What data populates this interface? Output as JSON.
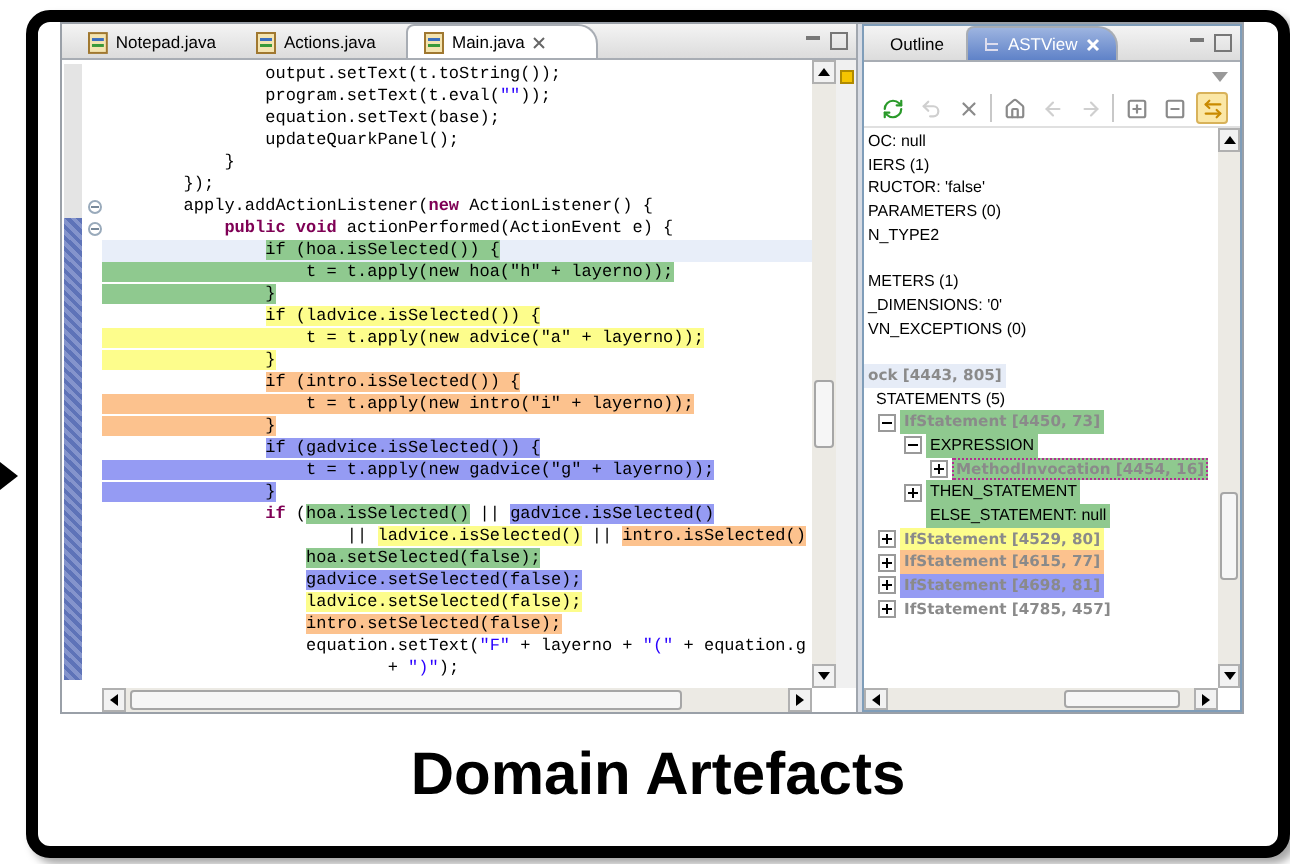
{
  "editor": {
    "tabs": [
      {
        "label": "Notepad.java",
        "selected": false
      },
      {
        "label": "Actions.java",
        "selected": false
      },
      {
        "label": "Main.java",
        "selected": true
      }
    ],
    "lines": [
      {
        "current": false,
        "range": false,
        "fold": false,
        "segments": [
          {
            "text": "                output.setText(t.toString());"
          }
        ]
      },
      {
        "current": false,
        "range": false,
        "fold": false,
        "segments": [
          {
            "text": "                program.setText(t.eval("
          },
          {
            "text": "\"\"",
            "kind": "string"
          },
          {
            "text": "));"
          }
        ]
      },
      {
        "current": false,
        "range": false,
        "fold": false,
        "segments": [
          {
            "text": "                equation.setText(base);"
          }
        ]
      },
      {
        "current": false,
        "range": false,
        "fold": false,
        "segments": [
          {
            "text": "                updateQuarkPanel();"
          }
        ]
      },
      {
        "current": false,
        "range": false,
        "fold": false,
        "segments": [
          {
            "text": "            }"
          }
        ]
      },
      {
        "current": false,
        "range": false,
        "fold": false,
        "segments": [
          {
            "text": "        });"
          }
        ]
      },
      {
        "current": false,
        "range": false,
        "fold": true,
        "segments": [
          {
            "text": "        apply.addActionListener("
          },
          {
            "text": "new",
            "kind": "keyword"
          },
          {
            "text": " ActionListener() {"
          }
        ]
      },
      {
        "current": false,
        "range": true,
        "fold": true,
        "segments": [
          {
            "text": "            public void",
            "kind": "keyword"
          },
          {
            "text": " actionPerformed(ActionEvent e) {"
          }
        ]
      },
      {
        "current": true,
        "range": true,
        "fold": false,
        "segments": [
          {
            "text": "                if (hoa.isSelected()) {",
            "color": "#8fc98f",
            "full": false
          }
        ]
      },
      {
        "current": false,
        "range": true,
        "fold": false,
        "segments": [
          {
            "text": "                    t = t.apply(new hoa(\"h\" + layerno));",
            "color": "#8fc98f",
            "full": true
          }
        ]
      },
      {
        "current": false,
        "range": true,
        "fold": false,
        "segments": [
          {
            "text": "                }",
            "color": "#8fc98f",
            "full": true
          }
        ]
      },
      {
        "current": false,
        "range": true,
        "fold": false,
        "segments": [
          {
            "text": "                if (ladvice.isSelected()) {",
            "color": "#fdfd8c",
            "full": false
          }
        ]
      },
      {
        "current": false,
        "range": true,
        "fold": false,
        "segments": [
          {
            "text": "                    t = t.apply(new advice(\"a\" + layerno));",
            "color": "#fdfd8c",
            "full": true
          }
        ]
      },
      {
        "current": false,
        "range": true,
        "fold": false,
        "segments": [
          {
            "text": "                }",
            "color": "#fdfd8c",
            "full": true
          }
        ]
      },
      {
        "current": false,
        "range": true,
        "fold": false,
        "segments": [
          {
            "text": "                if (intro.isSelected()) {",
            "color": "#fcc28e",
            "full": false
          }
        ]
      },
      {
        "current": false,
        "range": true,
        "fold": false,
        "segments": [
          {
            "text": "                    t = t.apply(new intro(\"i\" + layerno));",
            "color": "#fcc28e",
            "full": true
          }
        ]
      },
      {
        "current": false,
        "range": true,
        "fold": false,
        "segments": [
          {
            "text": "                }",
            "color": "#fcc28e",
            "full": true
          }
        ]
      },
      {
        "current": false,
        "range": true,
        "fold": false,
        "segments": [
          {
            "text": "                if (gadvice.isSelected()) {",
            "color": "#959bf3",
            "full": false
          }
        ]
      },
      {
        "current": false,
        "range": true,
        "fold": false,
        "segments": [
          {
            "text": "                    t = t.apply(new gadvice(\"g\" + layerno));",
            "color": "#959bf3",
            "full": true
          }
        ]
      },
      {
        "current": false,
        "range": true,
        "fold": false,
        "segments": [
          {
            "text": "                }",
            "color": "#959bf3",
            "full": true
          }
        ]
      },
      {
        "current": false,
        "range": true,
        "fold": false,
        "segments": [
          {
            "text": "                if",
            "kind": "keyword"
          },
          {
            "text": " ("
          },
          {
            "text": "hoa.isSelected()",
            "color": "#8fc98f"
          },
          {
            "text": " || "
          },
          {
            "text": "gadvice.isSelected()",
            "color": "#959bf3"
          }
        ]
      },
      {
        "current": false,
        "range": true,
        "fold": false,
        "segments": [
          {
            "text": "                        || "
          },
          {
            "text": "ladvice.isSelected()",
            "color": "#fdfd8c"
          },
          {
            "text": " || "
          },
          {
            "text": "intro.isSelected()",
            "color": "#fcc28e"
          }
        ]
      },
      {
        "current": false,
        "range": true,
        "fold": false,
        "segments": [
          {
            "text": "                    hoa.setSelected(false);",
            "color": "#8fc98f",
            "full": false
          }
        ]
      },
      {
        "current": false,
        "range": true,
        "fold": false,
        "segments": [
          {
            "text": "                    gadvice.setSelected(false);",
            "color": "#959bf3",
            "full": false
          }
        ]
      },
      {
        "current": false,
        "range": true,
        "fold": false,
        "segments": [
          {
            "text": "                    ladvice.setSelected(false);",
            "color": "#fdfd8c",
            "full": false
          }
        ]
      },
      {
        "current": false,
        "range": true,
        "fold": false,
        "segments": [
          {
            "text": "                    intro.setSelected(false);",
            "color": "#fcc28e",
            "full": false
          }
        ]
      },
      {
        "current": false,
        "range": true,
        "fold": false,
        "segments": [
          {
            "text": "                    equation.setText("
          },
          {
            "text": "\"F\"",
            "kind": "string"
          },
          {
            "text": " + layerno + "
          },
          {
            "text": "\"(\"",
            "kind": "string"
          },
          {
            "text": " + equation.g"
          }
        ]
      },
      {
        "current": false,
        "range": true,
        "fold": false,
        "segments": [
          {
            "text": "                            + "
          },
          {
            "text": "\")\"",
            "kind": "string"
          },
          {
            "text": ");"
          }
        ]
      }
    ]
  },
  "view": {
    "tabs": [
      {
        "label": "Outline",
        "selected": false
      },
      {
        "label": "ASTView",
        "selected": true
      }
    ],
    "toolbar": [
      {
        "kind": "refresh",
        "disabled": false,
        "selected": false
      },
      {
        "kind": "undo",
        "disabled": true,
        "selected": false
      },
      {
        "kind": "delete",
        "disabled": false,
        "selected": false
      },
      {
        "kind": "home",
        "disabled": false,
        "selected": false
      },
      {
        "kind": "back",
        "disabled": true,
        "selected": false
      },
      {
        "kind": "forward",
        "disabled": true,
        "selected": false
      },
      {
        "kind": "expand",
        "disabled": false,
        "selected": false
      },
      {
        "kind": "collapse",
        "disabled": false,
        "selected": false
      },
      {
        "kind": "link",
        "disabled": false,
        "selected": true
      }
    ],
    "tree_groups": [
      [
        {
          "label": "OC: null",
          "kind": "property",
          "selected": false
        },
        {
          "label": "IERS (1)",
          "kind": "property",
          "selected": false
        },
        {
          "label": "RUCTOR: 'false'",
          "kind": "property",
          "selected": false
        },
        {
          "label": "PARAMETERS (0)",
          "kind": "property",
          "selected": false
        },
        {
          "label": "N_TYPE2",
          "kind": "property",
          "selected": false
        }
      ],
      [
        {
          "label": "METERS (1)",
          "kind": "property",
          "selected": false
        },
        {
          "label": "_DIMENSIONS: '0'",
          "kind": "property",
          "selected": false
        },
        {
          "label": "VN_EXCEPTIONS (0)",
          "kind": "property",
          "selected": false
        }
      ],
      [
        {
          "label": "ock [4443, 805]",
          "kind": "node",
          "selected": false,
          "color": "#e6ecf7",
          "children": [
            {
              "label": "STATEMENTS (5)",
              "kind": "property",
              "selected": false,
              "children": [
                {
                  "label": "IfStatement [4450, 73]",
                  "kind": "node",
                  "selected": false,
                  "expanded": true,
                  "color": "#8fc98f",
                  "children": [
                    {
                      "label": "EXPRESSION",
                      "kind": "property",
                      "selected": false,
                      "expanded": true,
                      "color": "#8fc98f",
                      "children": [
                        {
                          "label": "MethodInvocation [4454, 16]",
                          "kind": "node",
                          "selected": true,
                          "expanded": false,
                          "color": "#8fc98f"
                        }
                      ]
                    },
                    {
                      "label": "THEN_STATEMENT",
                      "kind": "property",
                      "selected": false,
                      "expanded": false,
                      "color": "#8fc98f"
                    },
                    {
                      "label": "ELSE_STATEMENT: null",
                      "kind": "property",
                      "selected": false,
                      "color": "#8fc98f"
                    }
                  ]
                },
                {
                  "label": "IfStatement [4529, 80]",
                  "kind": "node",
                  "selected": false,
                  "expanded": false,
                  "color": "#fdfd8c"
                },
                {
                  "label": "IfStatement [4615, 77]",
                  "kind": "node",
                  "selected": false,
                  "expanded": false,
                  "color": "#fcc28e"
                },
                {
                  "label": "IfStatement [4698, 81]",
                  "kind": "node",
                  "selected": false,
                  "expanded": false,
                  "color": "#959bf3"
                },
                {
                  "label": "IfStatement [4785, 457]",
                  "kind": "node",
                  "selected": false,
                  "expanded": false
                }
              ]
            }
          ]
        }
      ]
    ]
  },
  "caption": "Domain Artefacts"
}
